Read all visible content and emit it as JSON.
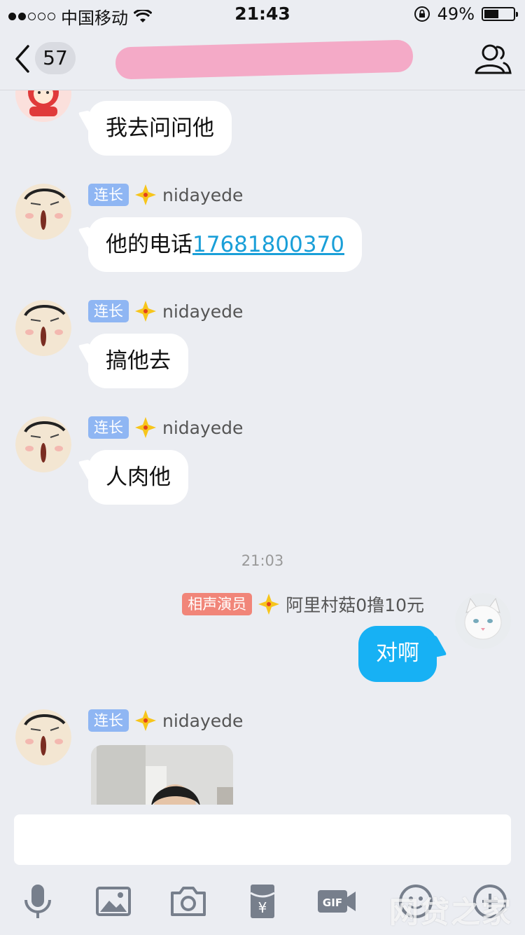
{
  "status": {
    "carrier": "中国移动",
    "time": "21:43",
    "battery": "49%",
    "battery_level": 0.49,
    "signal_bars": 2
  },
  "nav": {
    "unread_count": "57",
    "title": ""
  },
  "messages": [
    {
      "text": "我去问问他"
    },
    {
      "tag": "连长",
      "name": "nidayede",
      "text_prefix": "他的电话",
      "phone": "17681800370"
    },
    {
      "tag": "连长",
      "name": "nidayede",
      "text": "搞他去"
    },
    {
      "tag": "连长",
      "name": "nidayede",
      "text": "人肉他"
    },
    {
      "timestamp": "21:03"
    },
    {
      "tag": "相声演员",
      "name": "阿里村菇0撸10元",
      "text": "对啊"
    },
    {
      "tag": "连长",
      "name": "nidayede",
      "type": "image"
    }
  ],
  "toolbar": {
    "icons": [
      "microphone-icon",
      "image-icon",
      "camera-icon",
      "red-packet-icon",
      "gif-icon",
      "emoji-icon",
      "plus-icon"
    ],
    "gif_label": "GIF",
    "redpacket_symbol": "¥"
  },
  "watermark": "网贷之家",
  "colors": {
    "bubble_me": "#17b1f4",
    "link": "#1a9fd8",
    "tag_blue": "#8fb6f3",
    "tag_red": "#f18579",
    "bg": "#ebedf2"
  }
}
